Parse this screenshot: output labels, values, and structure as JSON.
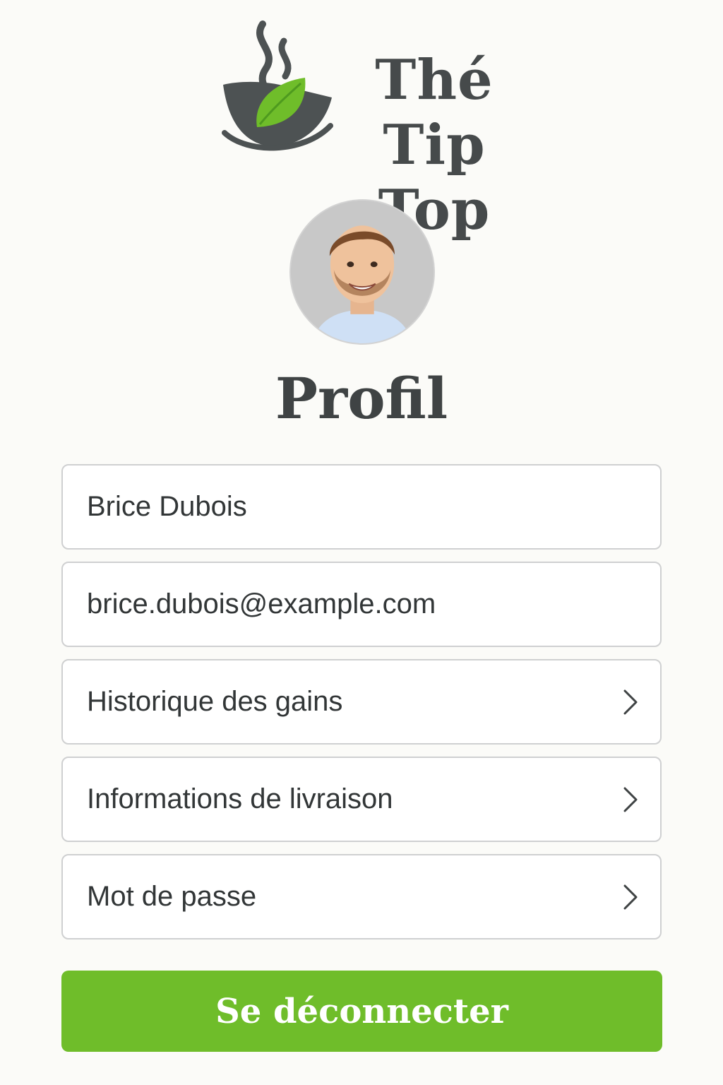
{
  "brand": {
    "name_line1": "Thé Tip",
    "name_line2": "Top",
    "colors": {
      "leaf": "#6fbd2a",
      "cup": "#4d5253"
    }
  },
  "profile": {
    "avatar_icon": "user-photo",
    "title": "Profil"
  },
  "fields": {
    "name": "Brice Dubois",
    "email": "brice.dubois@example.com"
  },
  "menu": {
    "history": "Historique des gains",
    "delivery": "Informations de livraison",
    "password": "Mot de passe",
    "icon": "chevron-right-icon"
  },
  "actions": {
    "logout": "Se déconnecter"
  },
  "colors": {
    "accent": "#6fbd2a",
    "text": "#3f4344",
    "border": "#cfd0d1",
    "background": "#fbfbf8"
  }
}
